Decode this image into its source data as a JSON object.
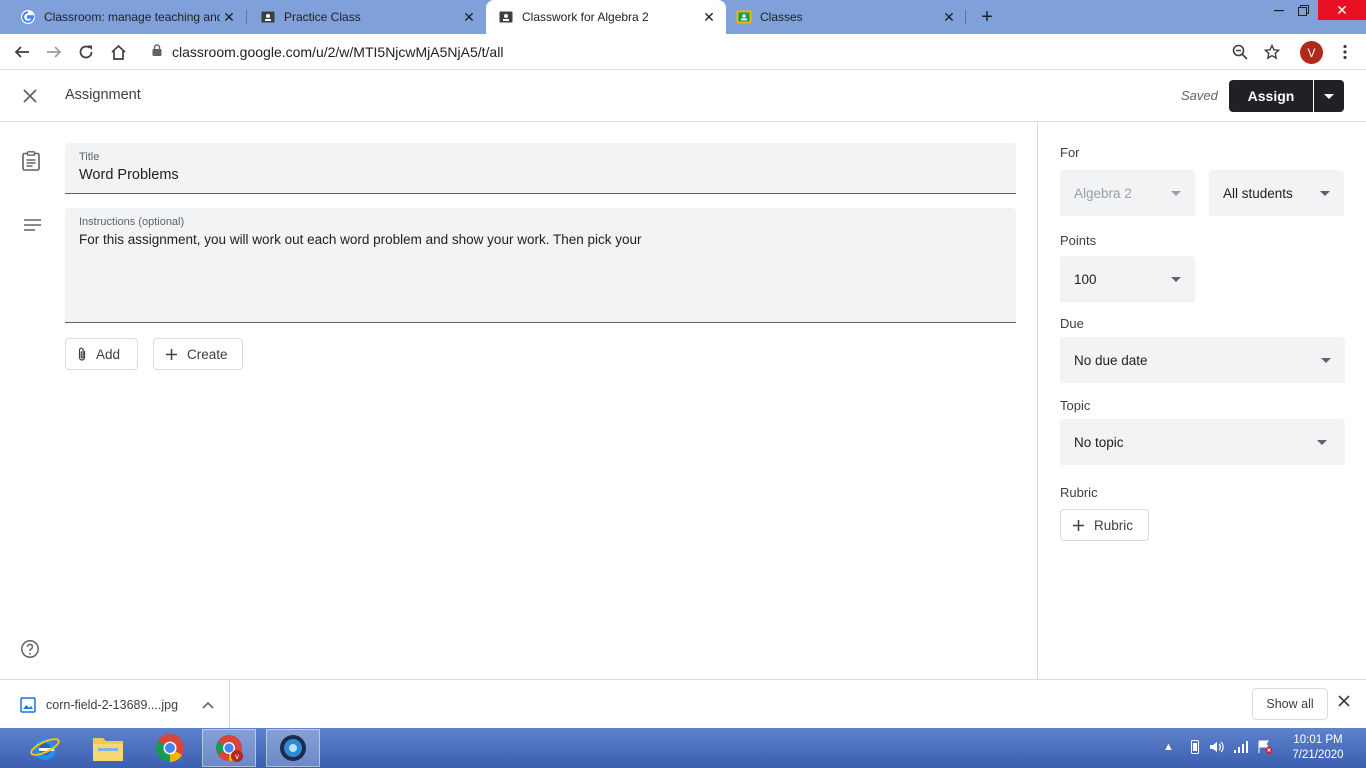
{
  "browser": {
    "tabs": [
      {
        "title": "Classroom: manage teaching and learning",
        "icon": "google-icon"
      },
      {
        "title": "Practice Class",
        "icon": "classroom-icon"
      },
      {
        "title": "Classwork for Algebra 2",
        "icon": "classroom-icon"
      },
      {
        "title": "Classes",
        "icon": "classroom-yellow-icon"
      }
    ],
    "active_tab": 2,
    "url": "classroom.google.com/u/2/w/MTI5NjcwMjA5NjA5/t/all",
    "profile_initial": "V"
  },
  "appbar": {
    "title": "Assignment",
    "status": "Saved",
    "assign_label": "Assign"
  },
  "form": {
    "title_label": "Title",
    "title_value": "Word Problems",
    "instructions_label": "Instructions (optional)",
    "instructions_value": "For this assignment, you will work out each word problem and show your work. Then pick your",
    "add_label": "Add",
    "create_label": "Create"
  },
  "sidebar": {
    "for_label": "For",
    "class_value": "Algebra 2",
    "students_value": "All students",
    "points_label": "Points",
    "points_value": "100",
    "due_label": "Due",
    "due_value": "No due date",
    "topic_label": "Topic",
    "topic_value": "No topic",
    "rubric_label": "Rubric",
    "rubric_button": "Rubric"
  },
  "downloads": {
    "file_name": "corn-field-2-13689....jpg",
    "show_all": "Show all"
  },
  "taskbar": {
    "time": "10:01 PM",
    "date": "7/21/2020"
  },
  "colors": {
    "tabstrip": "#7fa0d8",
    "assign_button": "#202124",
    "field_bg": "#f1f3f4",
    "avatar": "#b1281d"
  }
}
